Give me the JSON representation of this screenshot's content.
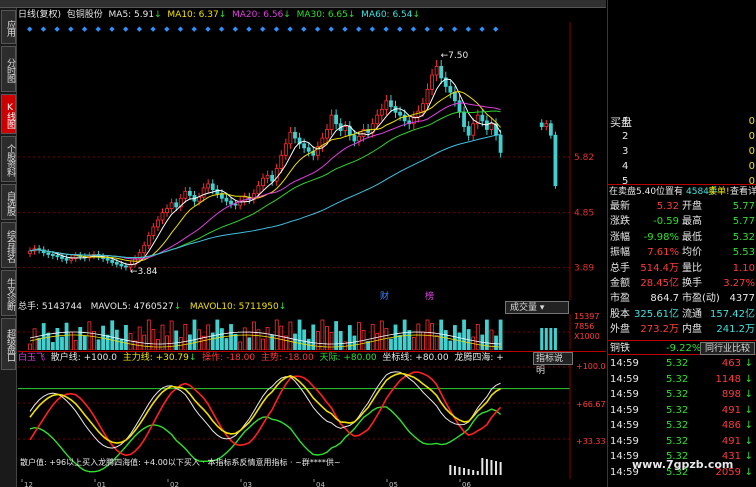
{
  "info": {
    "period": "日线(复权)",
    "mode": "包铜股份",
    "ma5": "MA5: 5.91",
    "ma10": "MA10: 6.37",
    "ma20": "MA20: 6.56",
    "ma30": "MA30: 6.65",
    "ma60": "MA60: 6.54"
  },
  "leftbar": [
    "应用",
    "分时图",
    "K线图",
    "个股资料",
    "自选股",
    "综合排名",
    "牛叉诊断",
    "超级盘口"
  ],
  "volume": {
    "total": "总手: 5143744",
    "mavol5": "MAVOL5: 4760527",
    "mavol10": "MAVOL10: 5711950",
    "selector": "成交量",
    "axis": [
      "15397",
      "7856",
      "X1000"
    ]
  },
  "indicator": {
    "name": "白玉飞",
    "s1": "散户线: +100.0",
    "s2": "主力线: +30.79",
    "s3": "操作: -18.00",
    "s4": "主势: -18.00",
    "s5": "天际: +80.00",
    "s6": "坐标线: +80.00",
    "s7": "龙腾四海: +",
    "help": "指标说明",
    "axis": [
      "+100.0",
      "+66.67",
      "+33.33"
    ],
    "note": "散户值: +96以上买入龙腾四海值: +4.00以下买入 · 本指标系反情意用指标 · ~群****供~"
  },
  "chart_data": {
    "type": "candlestick",
    "title": "",
    "xlabel": "",
    "ylabel": "",
    "ylim": [
      3.5,
      8.0
    ],
    "annotations": {
      "high": "7.50",
      "low": "3.84",
      "event1": "财",
      "event2": "榜"
    },
    "price_axis": [
      "5.82",
      "4.85",
      "3.89"
    ],
    "date_axis": [
      "12",
      "01",
      "02",
      "03",
      "04",
      "05",
      "06"
    ],
    "closes": [
      4.18,
      4.22,
      4.2,
      4.15,
      4.12,
      4.1,
      4.08,
      4.05,
      4.02,
      4.05,
      4.1,
      4.08,
      4.06,
      4.1,
      4.12,
      4.08,
      4.05,
      4.02,
      3.98,
      3.95,
      3.92,
      3.9,
      3.95,
      4.05,
      4.15,
      4.28,
      4.45,
      4.6,
      4.72,
      4.85,
      4.92,
      5.02,
      4.95,
      5.1,
      5.22,
      5.15,
      5.05,
      5.12,
      5.28,
      5.35,
      5.25,
      5.18,
      5.1,
      5.05,
      5.0,
      4.98,
      5.05,
      5.12,
      5.08,
      5.18,
      5.32,
      5.45,
      5.5,
      5.4,
      5.62,
      5.85,
      6.05,
      6.25,
      6.15,
      6.05,
      5.98,
      5.92,
      5.85,
      6.0,
      6.15,
      6.3,
      6.55,
      6.4,
      6.28,
      6.35,
      6.2,
      6.1,
      6.18,
      6.3,
      6.25,
      6.4,
      6.55,
      6.65,
      6.8,
      6.7,
      6.6,
      6.55,
      6.45,
      6.4,
      6.52,
      6.62,
      6.75,
      7.0,
      7.25,
      7.4,
      7.2,
      7.05,
      6.95,
      6.8,
      6.6,
      6.35,
      6.2,
      6.4,
      6.55,
      6.45,
      6.3,
      6.4,
      6.2,
      5.9
    ],
    "tail_closes": [
      6.35,
      6.4,
      6.2,
      5.32
    ]
  },
  "quote": {
    "buy_label": "买盘",
    "sell_label": "",
    "buys": [
      {
        "n": "1",
        "p": "",
        "v": "0"
      },
      {
        "n": "2",
        "p": "",
        "v": "0"
      },
      {
        "n": "3",
        "p": "",
        "v": "0"
      },
      {
        "n": "4",
        "p": "",
        "v": "0"
      },
      {
        "n": "5",
        "p": "",
        "v": "0"
      }
    ],
    "sell_on": "在卖盘5.40位置有",
    "sell_qty": "4584手",
    "sell_tip": "卖单!",
    "detail": "查看详细",
    "rows": [
      {
        "l1": "最新",
        "v1": "5.32",
        "l2": "开盘",
        "v2": "5.77"
      },
      {
        "l1": "涨跌",
        "v1": "-0.59",
        "l2": "最高",
        "v2": "5.77"
      },
      {
        "l1": "涨幅",
        "v1": "-9.98%",
        "l2": "最低",
        "v2": "5.32"
      },
      {
        "l1": "振幅",
        "v1": "7.61%",
        "l2": "均价",
        "v2": "5.53"
      },
      {
        "l1": "总手",
        "v1": "514.4万",
        "l2": "量比",
        "v2": "1.10"
      },
      {
        "l1": "金额",
        "v1": "28.45亿",
        "l2": "换手",
        "v2": "3.27%"
      },
      {
        "l1": "市盈",
        "v1": "864.7",
        "l2": "市盈(动)",
        "v2": "4377"
      },
      {
        "l1": "股本",
        "v1": "325.61亿",
        "l2": "流通",
        "v2": "157.42亿"
      },
      {
        "l1": "外盘",
        "v1": "273.2万",
        "l2": "内盘",
        "v2": "241.2万"
      }
    ],
    "sector": "铜铁",
    "sector_pct": "-9.22%",
    "sector_btn": "同行业比较",
    "ticks": [
      {
        "t": "14:59",
        "p": "5.32",
        "v": "463"
      },
      {
        "t": "14:59",
        "p": "5.32",
        "v": "1148"
      },
      {
        "t": "14:59",
        "p": "5.32",
        "v": "898"
      },
      {
        "t": "14:59",
        "p": "5.32",
        "v": "491"
      },
      {
        "t": "14:59",
        "p": "5.32",
        "v": "486"
      },
      {
        "t": "14:59",
        "p": "5.32",
        "v": "491"
      },
      {
        "t": "14:59",
        "p": "5.32",
        "v": "431"
      },
      {
        "t": "14:59",
        "p": "5.32",
        "v": "2059"
      }
    ]
  },
  "watermark": "www.7gpzb.com"
}
